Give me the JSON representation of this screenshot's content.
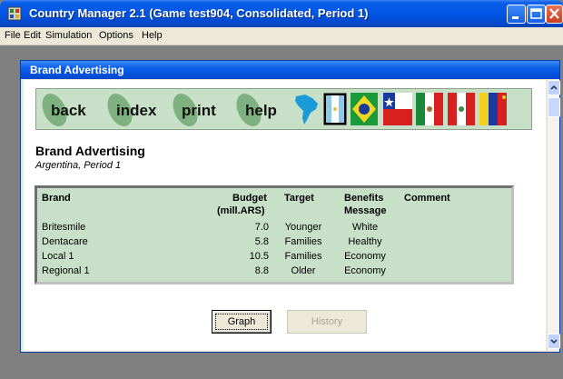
{
  "window": {
    "title": "Country Manager 2.1 (Game test904, Consolidated, Period 1)",
    "app_icon": "app-icon",
    "controls": [
      "minimize-icon",
      "maximize-icon",
      "close-icon"
    ]
  },
  "menu": {
    "items": [
      "File",
      "Edit",
      "Simulation",
      "Options",
      "Help"
    ]
  },
  "inner_window": {
    "title": "Brand Advertising"
  },
  "nav": {
    "buttons": [
      "back",
      "index",
      "print",
      "help"
    ],
    "flags": [
      "south-america-map",
      "argentina-flag",
      "brazil-flag",
      "chile-flag",
      "mexico-flag",
      "peru-flag",
      "venezuela-flag"
    ]
  },
  "report": {
    "title": "Brand Advertising",
    "subtitle": "Argentina, Period 1",
    "columns": {
      "brand": "Brand",
      "budget": "Budget",
      "budget_unit": "(mill.ARS)",
      "target": "Target",
      "benefits": "Benefits",
      "benefits_2": "Message",
      "comment": "Comment"
    },
    "rows": [
      {
        "brand": "Britesmile",
        "budget": "7.0",
        "target": "Younger",
        "benefits": "White",
        "comment": ""
      },
      {
        "brand": "Dentacare",
        "budget": "5.8",
        "target": "Families",
        "benefits": "Healthy",
        "comment": ""
      },
      {
        "brand": "Local 1",
        "budget": "10.5",
        "target": "Families",
        "benefits": "Economy",
        "comment": ""
      },
      {
        "brand": "Regional 1",
        "budget": "8.8",
        "target": "Older",
        "benefits": "Economy",
        "comment": ""
      }
    ]
  },
  "actions": {
    "graph": "Graph",
    "history": "History"
  },
  "colors": {
    "panel_green": "#c8e0c8",
    "xp_blue": "#0055e5"
  }
}
